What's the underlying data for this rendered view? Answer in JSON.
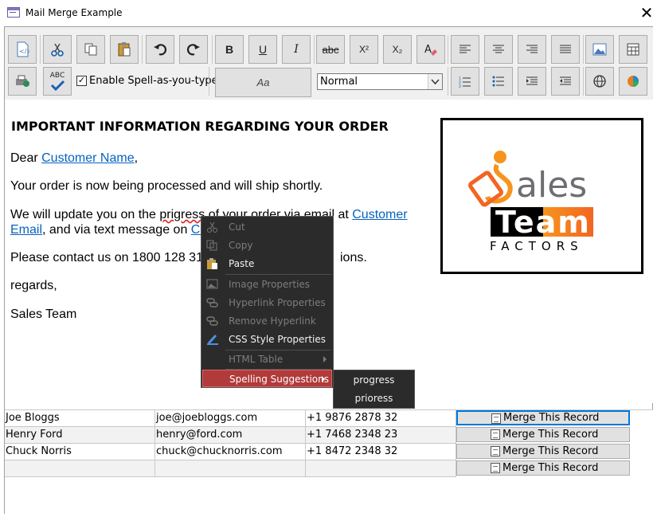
{
  "window": {
    "title": "Mail Merge Example",
    "close_glyph": "✕"
  },
  "toolbar": {
    "spell_checkbox": {
      "checked_glyph": "✓",
      "label": "Enable Spell-as-you-type"
    },
    "style_button_label": "Aa",
    "format_select": {
      "value": "Normal"
    },
    "bold": "B",
    "underline": "U",
    "italic": "I",
    "strike": "abc",
    "superscript": "X²",
    "subscript": "X₂",
    "spell_icon_text": "ABC"
  },
  "document": {
    "heading": "IMPORTANT INFORMATION REGARDING YOUR ORDER",
    "greeting_prefix": "Dear ",
    "greeting_link": "Customer Name",
    "greeting_suffix": ",",
    "line1": "Your order is now being processed and will ship shortly.",
    "line2_prefix": "We will update you on the ",
    "line2_misspelled": "prigress",
    "line2_middle": " of your order via email at ",
    "line2_link1": "Customer",
    "line3_link1_cont": "Email",
    "line3_middle": ", and via text message on ",
    "line3_link2": "Cu",
    "line4_prefix": "Please contact us on 1800 128 31",
    "line4_suffix": "ions.",
    "regards": "regards,",
    "signature": "Sales Team"
  },
  "logo": {
    "word1": "ales",
    "word2": "Team",
    "word3": "FACTORS"
  },
  "context_menu": {
    "items": [
      {
        "label": "Cut",
        "enabled": false
      },
      {
        "label": "Copy",
        "enabled": false
      },
      {
        "label": "Paste",
        "enabled": true
      },
      {
        "label": "Image Properties",
        "enabled": false
      },
      {
        "label": "Hyperlink Properties",
        "enabled": false
      },
      {
        "label": "Remove Hyperlink",
        "enabled": false
      },
      {
        "label": "CSS Style Properties",
        "enabled": true
      },
      {
        "label": "HTML Table",
        "enabled": false
      },
      {
        "label": "Spelling Suggestions",
        "enabled": true
      }
    ],
    "suggestions": [
      "progress",
      "prioress"
    ]
  },
  "grid": {
    "rows": [
      {
        "name": "Joe Bloggs",
        "email": "joe@joebloggs.com",
        "phone": "+1 9876 2878 32",
        "button": "Merge This Record"
      },
      {
        "name": "Henry Ford",
        "email": "henry@ford.com",
        "phone": "+1 7468 2348 23",
        "button": "Merge This Record"
      },
      {
        "name": "Chuck Norris",
        "email": "chuck@chucknorris.com",
        "phone": "+1 8472 2348 32",
        "button": "Merge This Record"
      },
      {
        "name": "",
        "email": "",
        "phone": "",
        "button": "Merge This Record"
      }
    ]
  },
  "colors": {
    "link": "#0563c1",
    "menu_bg": "#2b2b2b",
    "menu_highlight": "#b13a3a",
    "focus": "#0078d7"
  }
}
